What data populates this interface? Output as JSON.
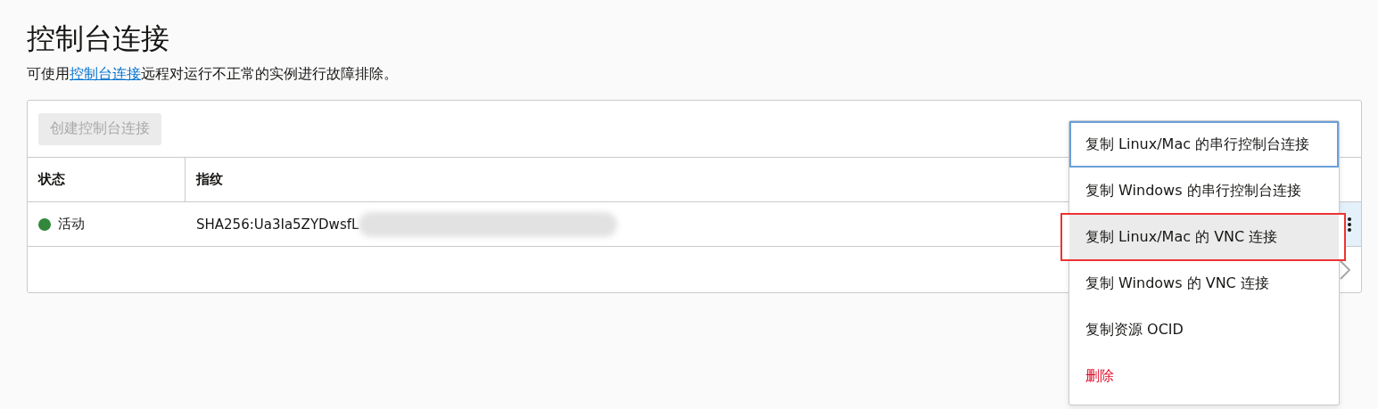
{
  "page": {
    "title": "控制台连接",
    "description_before": "可使用",
    "description_link": "控制台连接",
    "description_after": "远程对运行不正常的实例进行故障排除。"
  },
  "toolbar": {
    "create_button": {
      "label": "创建控制台连接",
      "disabled": true
    }
  },
  "table": {
    "columns": [
      "状态",
      "指纹"
    ],
    "rows": [
      {
        "status": "活动",
        "color": "#32883a",
        "fingerprint": "SHA256:Ua3Ia5ZYDwsfL",
        "fingerprint_blurred": true,
        "actions_open": true
      }
    ]
  },
  "menu": {
    "items": [
      {
        "label": "复制 Linux/Mac 的串行控制台连接",
        "kind": "normal",
        "focused": true,
        "hovered": false,
        "outlined": false
      },
      {
        "label": "复制 Windows 的串行控制台连接",
        "kind": "normal",
        "focused": false,
        "hovered": false,
        "outlined": false
      },
      {
        "label": "复制 Linux/Mac 的 VNC 连接",
        "kind": "normal",
        "focused": false,
        "hovered": true,
        "outlined": true
      },
      {
        "label": "复制 Windows 的 VNC 连接",
        "kind": "normal",
        "focused": false,
        "hovered": false,
        "outlined": false
      },
      {
        "label": "复制资源 OCID",
        "kind": "normal",
        "focused": false,
        "hovered": false,
        "outlined": false
      },
      {
        "label": "删除",
        "kind": "danger",
        "focused": false,
        "hovered": false,
        "outlined": false
      }
    ]
  }
}
